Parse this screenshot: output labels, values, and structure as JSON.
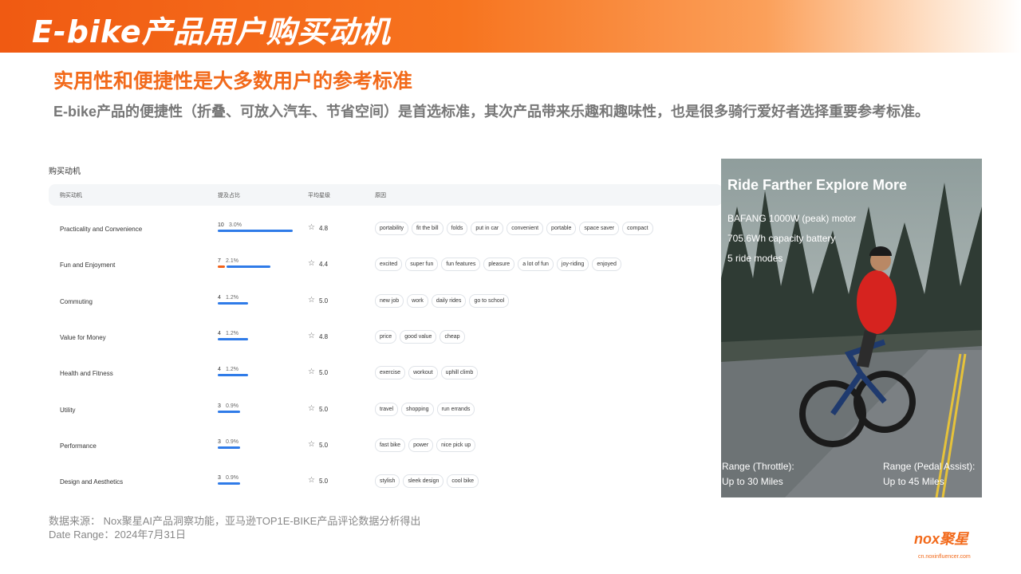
{
  "banner": {
    "title": "E-bike产品用户购买动机"
  },
  "headline": "实用性和便捷性是大多数用户的参考标准",
  "subline": "E-bike产品的便捷性（折叠、可放入汽车、节省空间）是首选标准，其次产品带来乐趣和趣味性，也是很多骑行爱好者选择重要参考标准。",
  "section_title": "购买动机",
  "table": {
    "columns": [
      "购买动机",
      "提及占比",
      "平均星级",
      "原因"
    ],
    "rows": [
      {
        "name": "Practicality and Convenience",
        "count": "10",
        "pct": "3.0%",
        "share": 3.0,
        "rating": "4.8",
        "tags": [
          "portability",
          "fit the bill",
          "folds",
          "put in car",
          "convenient",
          "portable",
          "space saver",
          "compact"
        ]
      },
      {
        "name": "Fun and Enjoyment",
        "count": "7",
        "pct": "2.1%",
        "share": 2.1,
        "rating": "4.4",
        "tags": [
          "excited",
          "super fun",
          "fun features",
          "pleasure",
          "a lot of fun",
          "joy-riding",
          "enjoyed"
        ]
      },
      {
        "name": "Commuting",
        "count": "4",
        "pct": "1.2%",
        "share": 1.2,
        "rating": "5.0",
        "tags": [
          "new job",
          "work",
          "daily rides",
          "go to school"
        ]
      },
      {
        "name": "Value for Money",
        "count": "4",
        "pct": "1.2%",
        "share": 1.2,
        "rating": "4.8",
        "tags": [
          "price",
          "good value",
          "cheap"
        ]
      },
      {
        "name": "Health and Fitness",
        "count": "4",
        "pct": "1.2%",
        "share": 1.2,
        "rating": "5.0",
        "tags": [
          "exercise",
          "workout",
          "uphill climb"
        ]
      },
      {
        "name": "Utility",
        "count": "3",
        "pct": "0.9%",
        "share": 0.9,
        "rating": "5.0",
        "tags": [
          "travel",
          "shopping",
          "run errands"
        ]
      },
      {
        "name": "Performance",
        "count": "3",
        "pct": "0.9%",
        "share": 0.9,
        "rating": "5.0",
        "tags": [
          "fast bike",
          "power",
          "nice pick up"
        ]
      },
      {
        "name": "Design and Aesthetics",
        "count": "3",
        "pct": "0.9%",
        "share": 0.9,
        "rating": "5.0",
        "tags": [
          "stylish",
          "sleek design",
          "cool bike"
        ]
      }
    ]
  },
  "photo": {
    "title": "Ride Farther Explore More",
    "lines": [
      "BAFANG 1000W (peak) motor",
      "705.6Wh capacity battery",
      "5 ride modes"
    ],
    "range_throttle_label": "Range (Throttle):",
    "range_throttle_value": "Up to 30 Miles",
    "range_pedal_label": "Range (Pedal Assist):",
    "range_pedal_value": "Up to 45 Miles"
  },
  "footer": {
    "source": "数据来源：  Nox聚星AI产品洞察功能，亚马逊TOP1E-BIKE产品评论数据分析得出",
    "date": "Date Range：2024年7月31日"
  },
  "logo": {
    "mark": "nox聚星",
    "url": "cn.noxinfluencer.com"
  },
  "colors": {
    "accent": "#f26a1b",
    "bar": "#2f7be8"
  },
  "icons": {
    "rating": "star-icon"
  }
}
